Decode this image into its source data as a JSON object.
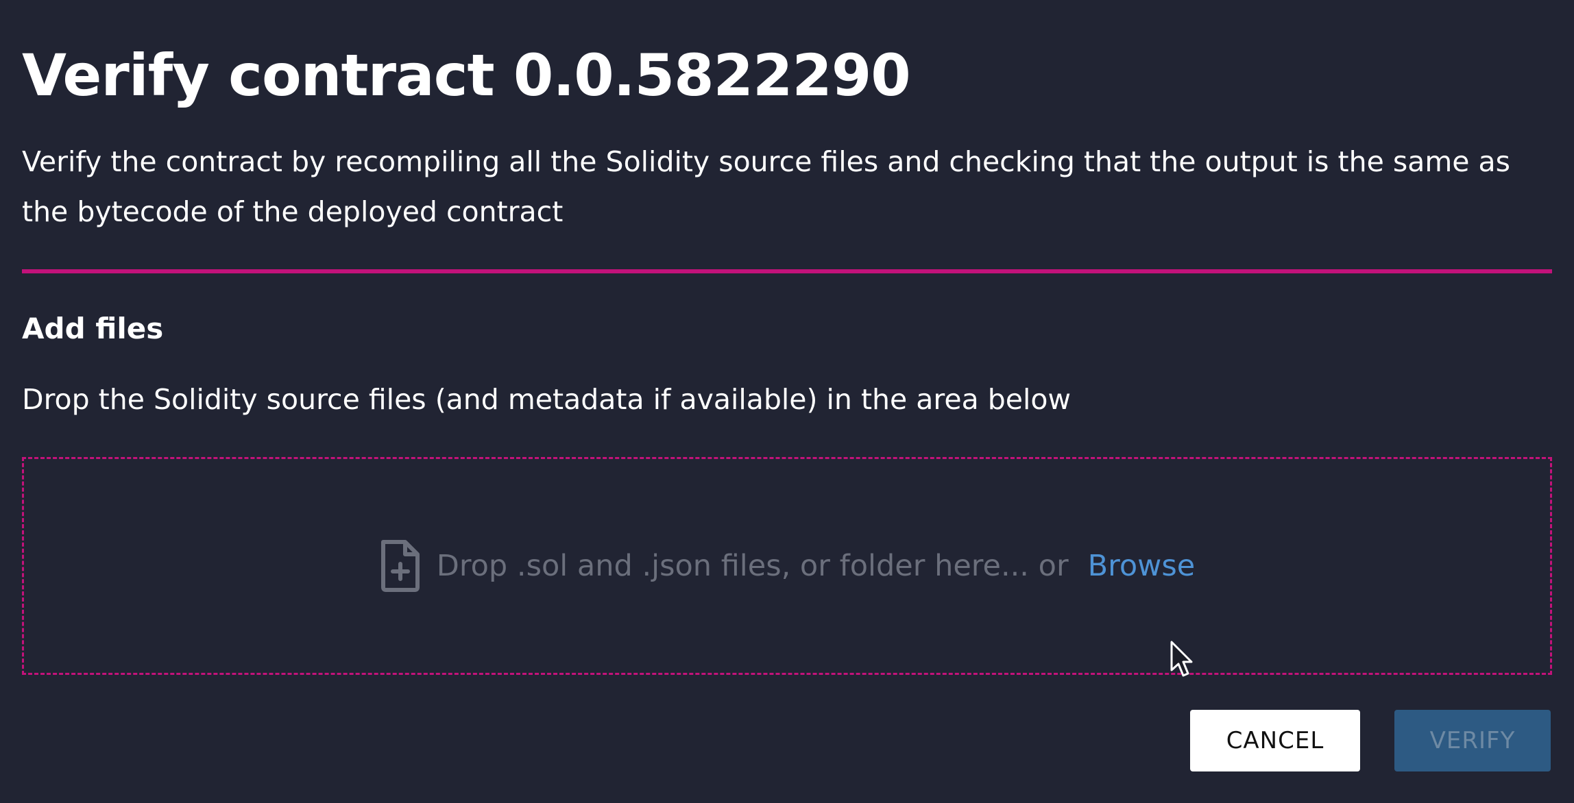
{
  "dialog": {
    "title": "Verify contract 0.0.5822290",
    "description": "Verify the contract by recompiling all the Solidity source files and checking that the output is the same as the bytecode of the deployed contract",
    "accent_color": "#c2127a"
  },
  "add_files": {
    "title": "Add files",
    "instructions": "Drop the Solidity source files (and metadata if available) in the area below"
  },
  "dropzone": {
    "icon": "file-add-icon",
    "text": "Drop .sol and .json files, or folder here... or",
    "browse_label": "Browse"
  },
  "actions": {
    "cancel_label": "CANCEL",
    "verify_label": "VERIFY",
    "verify_disabled": true
  }
}
